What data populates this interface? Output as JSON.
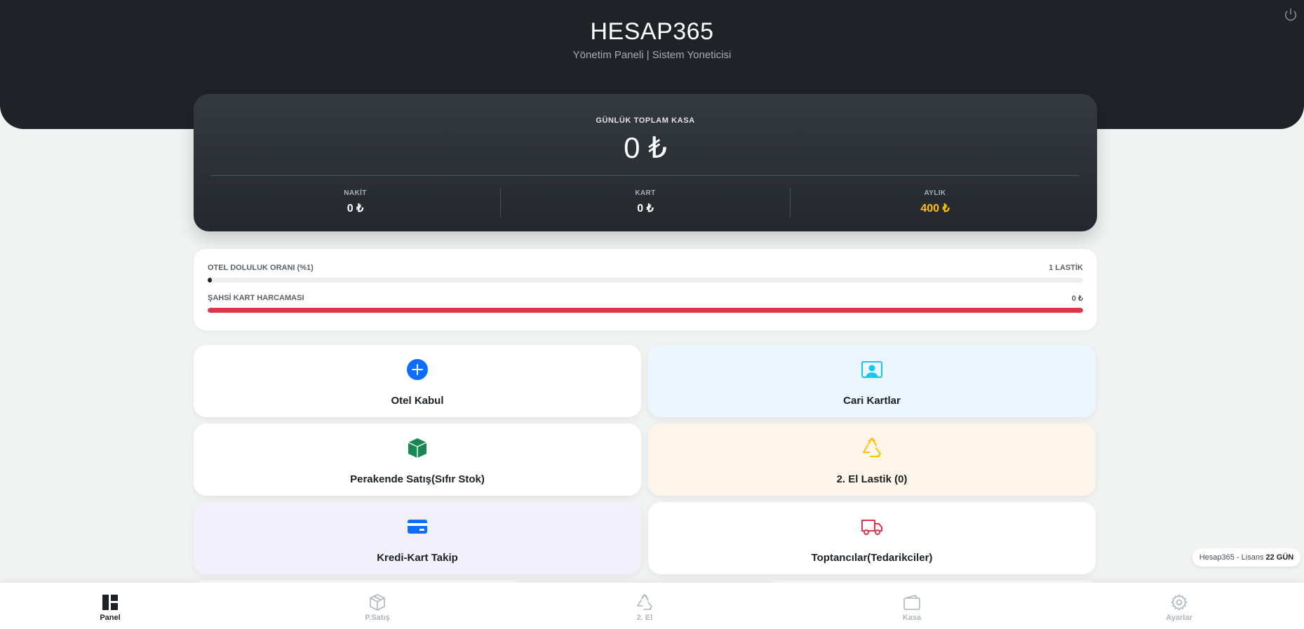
{
  "header": {
    "title": "HESAP365",
    "subtitle": "Yönetim Paneli | Sistem Yoneticisi",
    "power_icon": "power-icon"
  },
  "kasa": {
    "label": "GÜNLÜK TOPLAM KASA",
    "total": "0 ₺",
    "cells": [
      {
        "label": "NAKİT",
        "value": "0 ₺"
      },
      {
        "label": "KART",
        "value": "0 ₺"
      },
      {
        "label": "AYLIK",
        "value": "400 ₺"
      }
    ],
    "accent_color": "#ffc107"
  },
  "progress": [
    {
      "label": "OTEL DOLULUK ORANI (%1)",
      "right": "1 LASTİK",
      "percent": 0.5,
      "color": "#212529"
    },
    {
      "label": "ŞAHSİ KART HARCAMASI",
      "right": "0 ₺",
      "percent": 100,
      "color": "#dc3545"
    }
  ],
  "tiles": [
    {
      "label": "Otel Kabul",
      "icon": "plus-circle-icon",
      "bg": "#ffffff"
    },
    {
      "label": "Cari Kartlar",
      "icon": "person-card-icon",
      "bg": "#edf6fc"
    },
    {
      "label": "Perakende Satış(Sıfır Stok)",
      "icon": "box-icon",
      "bg": "#ffffff"
    },
    {
      "label": "2. El Lastik (0)",
      "icon": "recycle-icon",
      "bg": "#fdf4ea"
    },
    {
      "label": "Kredi-Kart Takip",
      "icon": "credit-card-icon",
      "bg": "#f2f1fb"
    },
    {
      "label": "Toptancılar(Tedarikciler)",
      "icon": "truck-icon",
      "bg": "#ffffff"
    }
  ],
  "license": {
    "text": "Hesap365 - Lisans ",
    "days": "22 GÜN"
  },
  "nav": [
    {
      "label": "Panel",
      "icon": "dashboard-icon",
      "active": true
    },
    {
      "label": "P.Satış",
      "icon": "box-icon",
      "active": false
    },
    {
      "label": "2. El",
      "icon": "recycle-icon",
      "active": false
    },
    {
      "label": "Kasa",
      "icon": "wallet-icon",
      "active": false
    },
    {
      "label": "Ayarlar",
      "icon": "gear-icon",
      "active": false
    }
  ]
}
